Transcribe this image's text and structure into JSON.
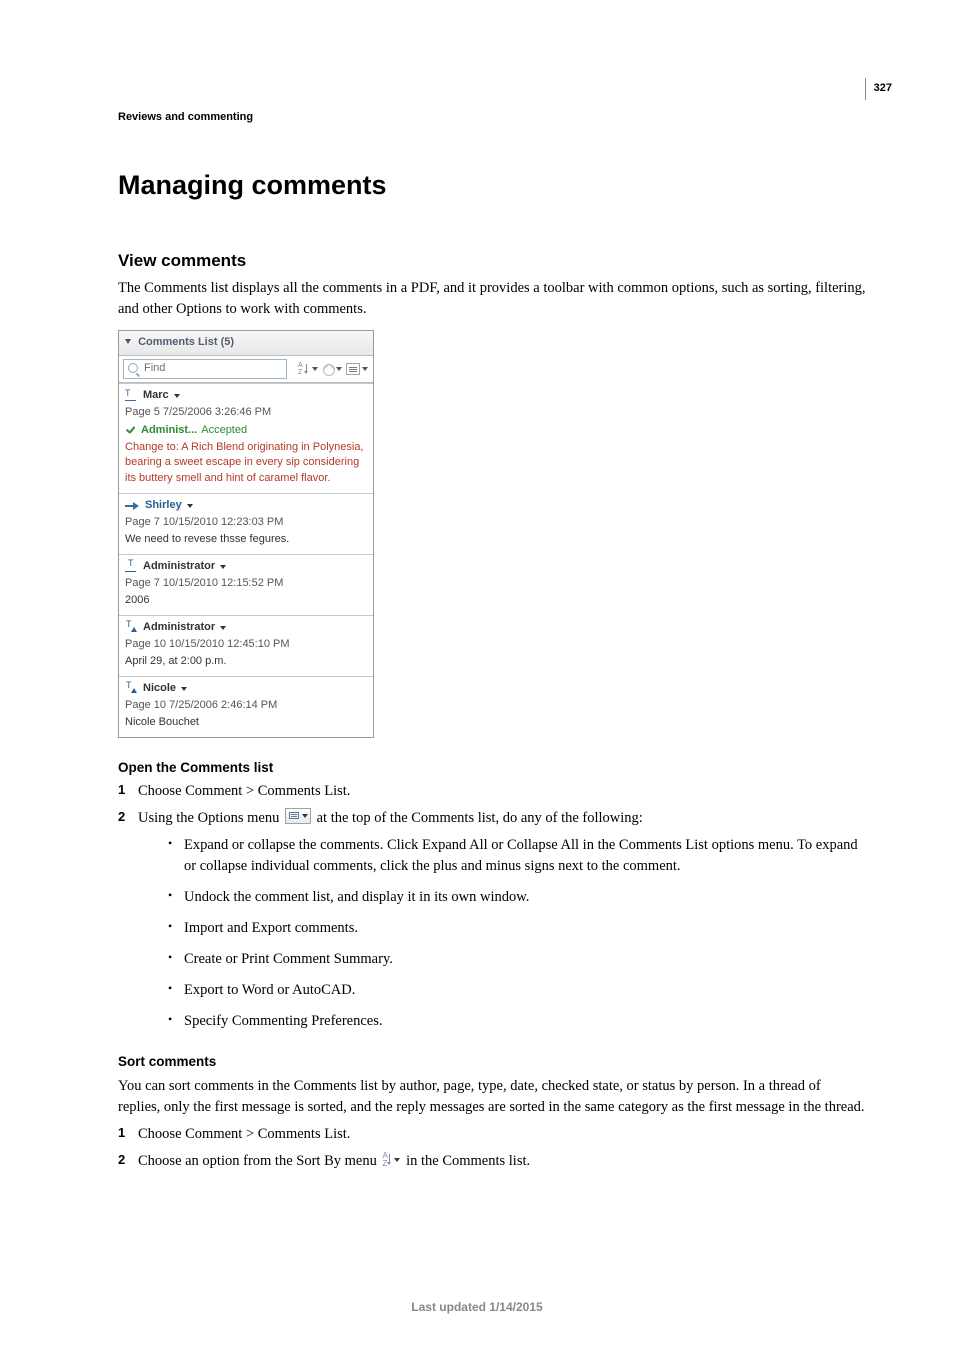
{
  "page_number": "327",
  "running_head": "Reviews and commenting",
  "h1": "Managing comments",
  "h2_view": "View comments",
  "p_view": "The Comments list displays all the comments in a PDF, and it provides a toolbar with common options, such as sorting, filtering, and other Options to work with comments.",
  "panel": {
    "title": "Comments List (5)",
    "find_placeholder": "Find",
    "items": [
      {
        "author": "Marc",
        "meta": "Page 5  7/25/2006 3:26:46 PM",
        "status_name": "Administ...",
        "status_value": "Accepted",
        "body": "Change to: A Rich Blend originating in Polynesia, bearing a sweet escape in every sip considering its buttery smell and hint of caramel flavor."
      },
      {
        "author": "Shirley",
        "meta": "Page 7  10/15/2010 12:23:03 PM",
        "body": "We need to revese thsse fegures."
      },
      {
        "author": "Administrator",
        "meta": "Page 7  10/15/2010 12:15:52 PM",
        "body": "2006"
      },
      {
        "author": "Administrator",
        "meta": "Page 10  10/15/2010 12:45:10 PM",
        "body": "April 29, at 2:00 p.m."
      },
      {
        "author": "Nicole",
        "meta": "Page 10  7/25/2006 2:46:14 PM",
        "body": "Nicole Bouchet"
      }
    ]
  },
  "h3_open": "Open the Comments list",
  "open_step1": "Choose Comment > Comments List.",
  "open_step2_a": "Using the Options menu ",
  "open_step2_b": " at the top of the Comments list, do any of the following:",
  "open_bul1": "Expand or collapse the comments. Click Expand All or Collapse All in the Comments List options menu. To expand or collapse individual comments, click the plus and minus signs next to the comment.",
  "open_bul2": "Undock the comment list, and display it in its own window.",
  "open_bul3": "Import and Export comments.",
  "open_bul4": "Create or Print Comment Summary.",
  "open_bul5": "Export to Word or AutoCAD.",
  "open_bul6": "Specify Commenting Preferences.",
  "h3_sort": "Sort comments",
  "p_sort": "You can sort comments in the Comments list by author, page, type, date, checked state, or status by person. In a thread of replies, only the first message is sorted, and the reply messages are sorted in the same category as the first message in the thread.",
  "sort_step1": "Choose Comment > Comments List.",
  "sort_step2_a": "Choose an option from the Sort By menu ",
  "sort_step2_b": " in the Comments list.",
  "footer": "Last updated 1/14/2015"
}
